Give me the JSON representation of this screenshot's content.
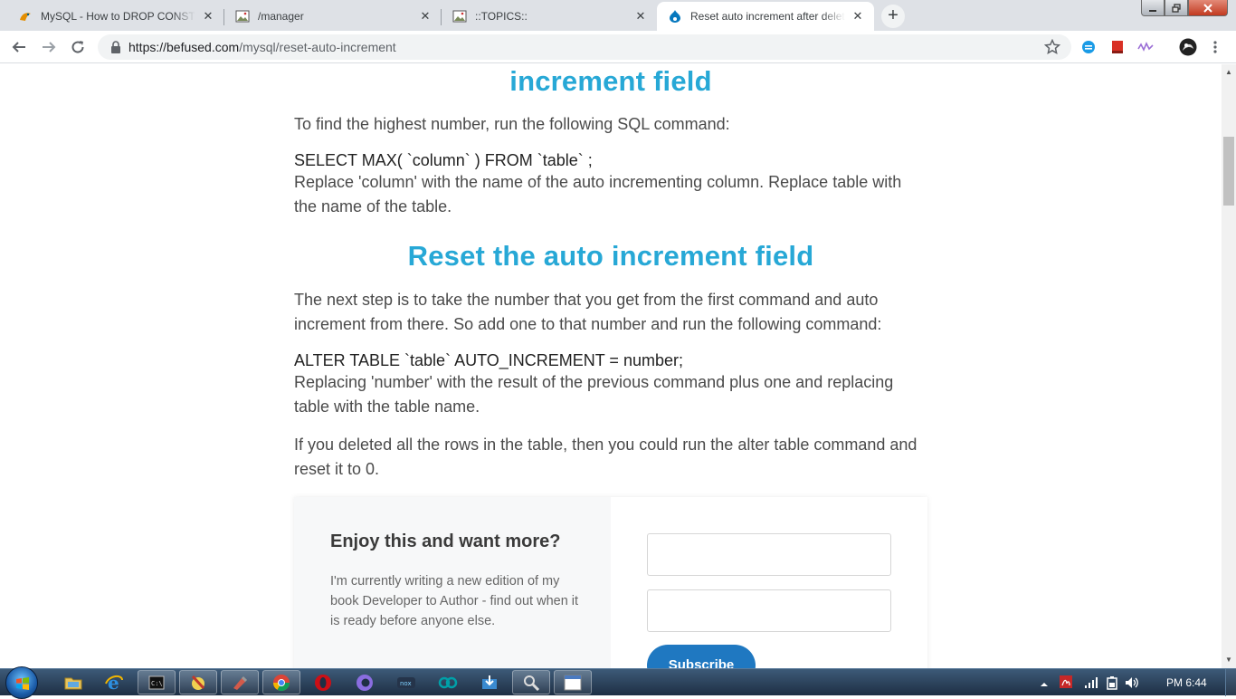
{
  "browser": {
    "tabs": [
      {
        "title": "MySQL - How to DROP CONSTRAINT",
        "favicon": "mysql-icon"
      },
      {
        "title": "/manager",
        "favicon": "image-icon"
      },
      {
        "title": "::TOPICS::",
        "favicon": "image-icon"
      },
      {
        "title": "Reset auto increment after deleting",
        "favicon": "drupal-icon",
        "active": true
      }
    ],
    "new_tab_label": "+",
    "url_host": "https://befused.com",
    "url_path": "/mysql/reset-auto-increment"
  },
  "article": {
    "heading_partial": "increment field",
    "para1": "To find the highest number, run the following SQL command:",
    "code1": "SELECT MAX( `column` ) FROM `table` ;",
    "para2": "Replace 'column' with the name of the auto incrementing column. Replace table with the name of the table.",
    "heading2": "Reset the auto increment field",
    "para3": "The next step is to take the number that you get from the first command and auto increment from there. So add one to that number and run the following command:",
    "code2": "ALTER TABLE `table` AUTO_INCREMENT = number;",
    "para4": "Replacing 'number' with the result of the previous command plus one and replacing table with the table name.",
    "para5": "If you deleted all the rows in the table, then you could run the alter table command and reset it to 0."
  },
  "subscribe": {
    "title": "Enjoy this and want more?",
    "description": "I'm currently writing a new edition of my book Developer to Author - find out when it is ready before anyone else.",
    "button_label": "Subscribe"
  },
  "taskbar": {
    "clock": "PM 6:44"
  },
  "colors": {
    "heading": "#27a8d6",
    "subscribe_button": "#1f78c1"
  }
}
